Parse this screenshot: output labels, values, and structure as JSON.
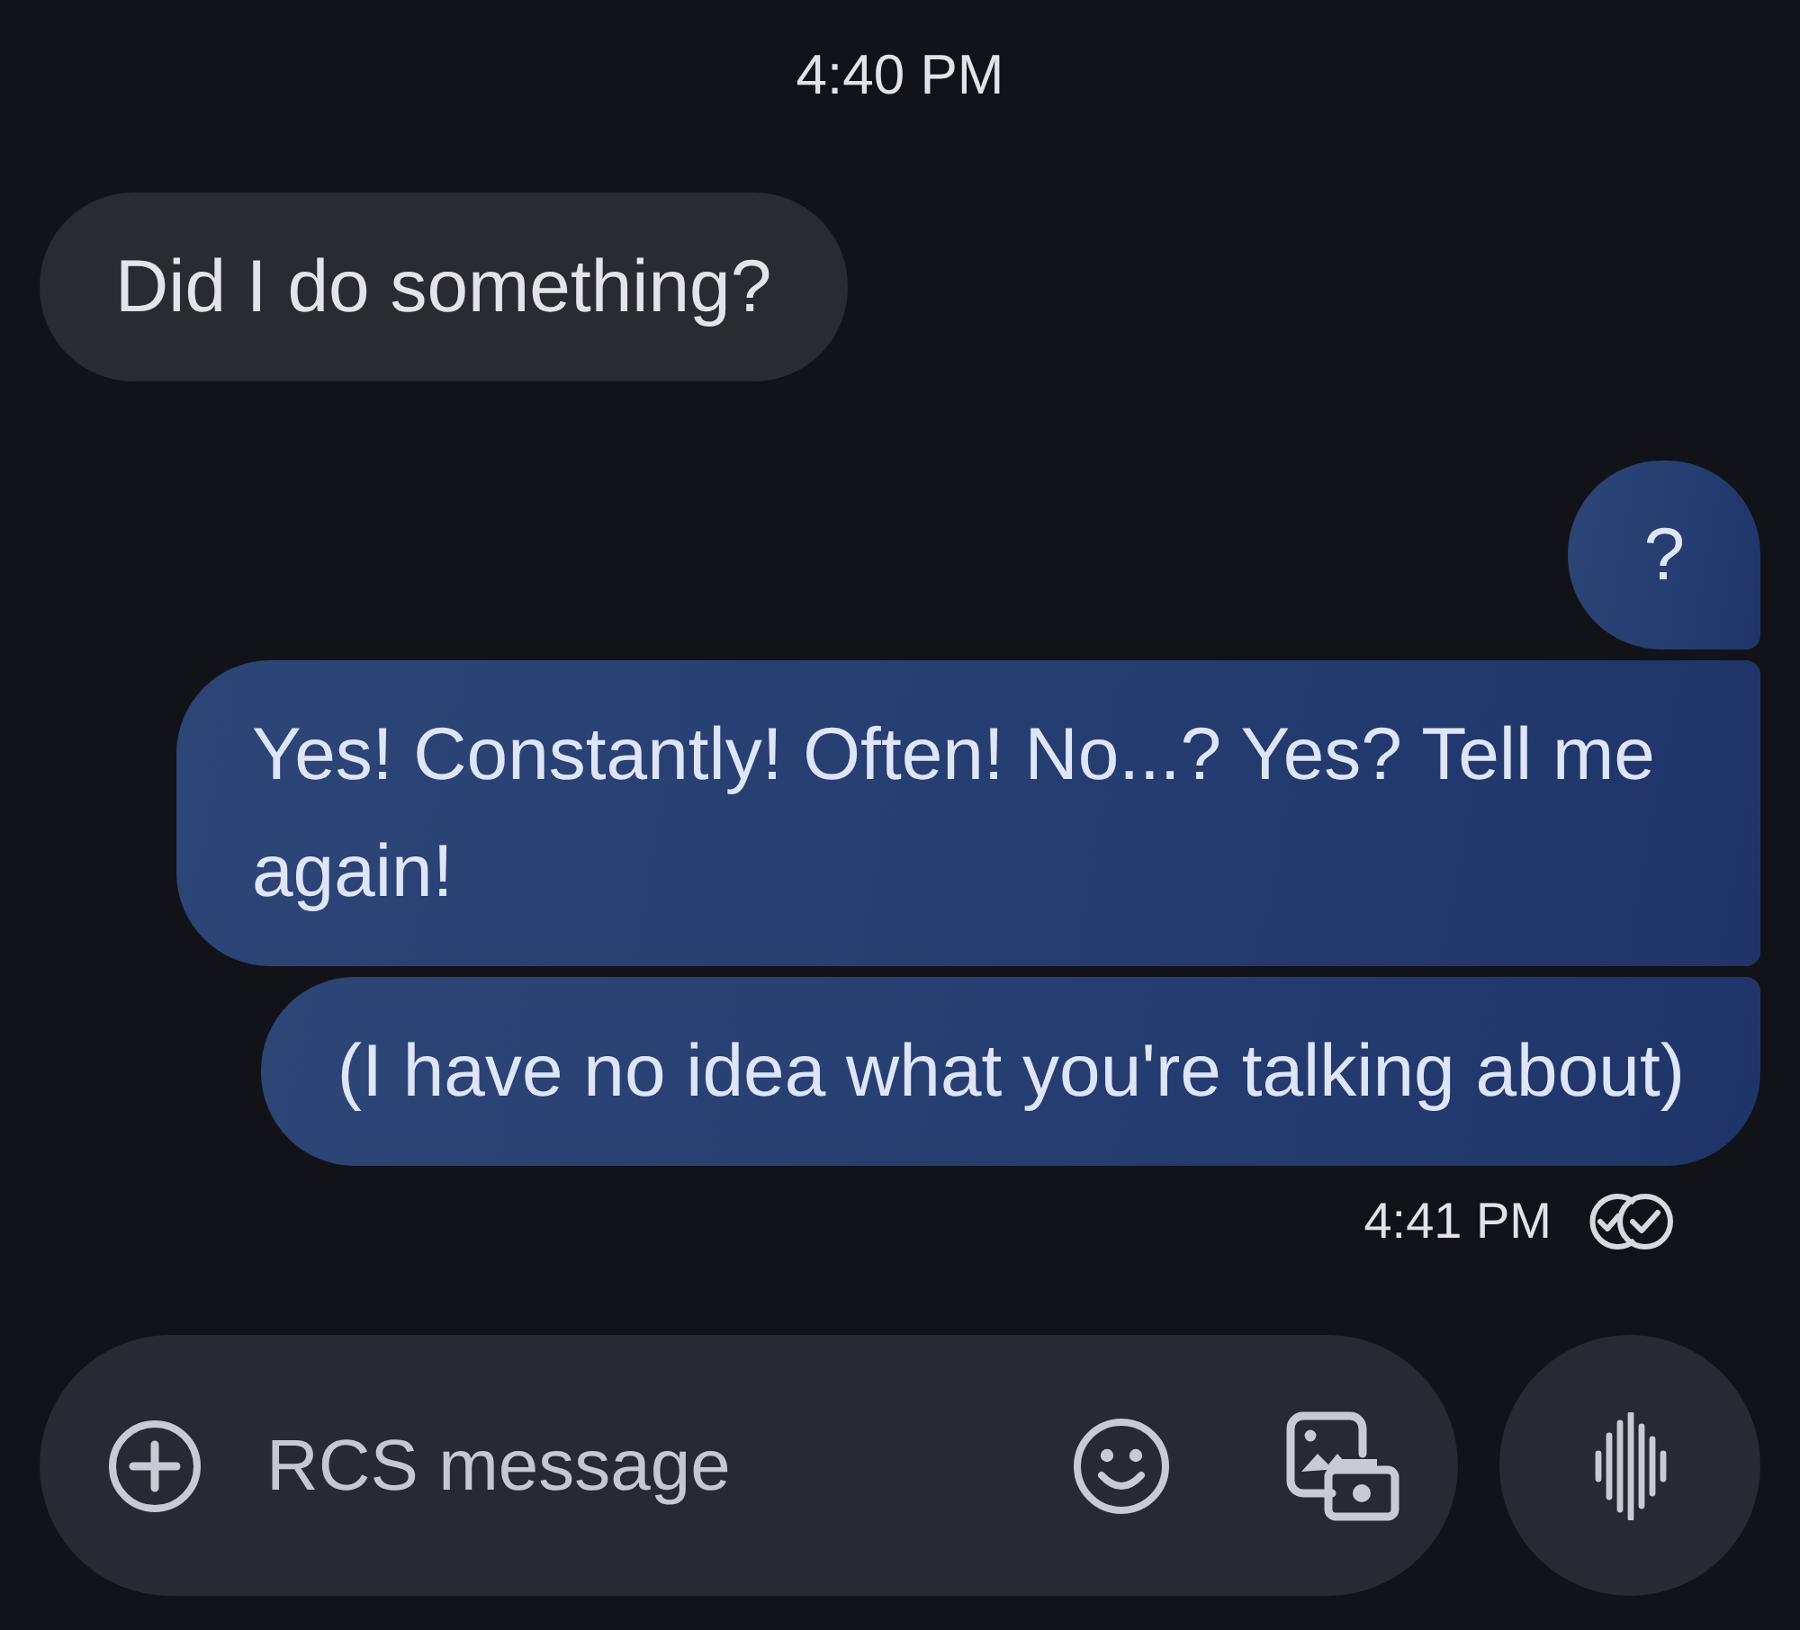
{
  "header": {
    "time": "4:40 PM"
  },
  "messages": [
    {
      "kind": "incoming",
      "text": "Did I do something?"
    },
    {
      "kind": "outgoing",
      "text": "?"
    },
    {
      "kind": "outgoing",
      "text": "Yes! Constantly! Often! No...? Yes? Tell me again!"
    },
    {
      "kind": "outgoing",
      "text": "(I have no idea what you're talking about)"
    }
  ],
  "sent_info": {
    "time": "4:41 PM",
    "delivered": true
  },
  "composer": {
    "placeholder": "RCS message"
  }
}
